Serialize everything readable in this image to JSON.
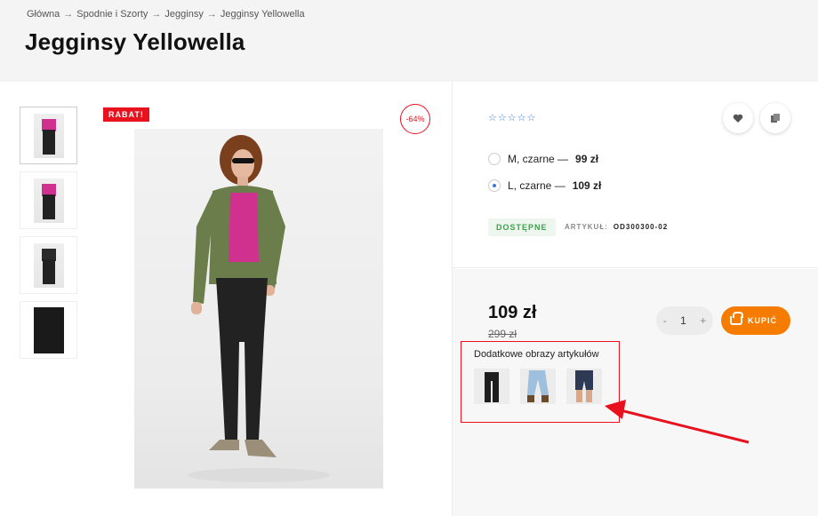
{
  "breadcrumb": {
    "items": [
      "Główna",
      "Spodnie i Szorty",
      "Jegginsy",
      "Jegginsy Yellowella"
    ],
    "separator": "→"
  },
  "page": {
    "title": "Jegginsy Yellowella"
  },
  "gallery": {
    "badge_label": "RABAT!",
    "discount_label": "-64%"
  },
  "product": {
    "rating_stars": "☆☆☆☆☆",
    "variants": [
      {
        "label": "M, czarne —",
        "price": "99 zł",
        "selected": false
      },
      {
        "label": "L, czarne —",
        "price": "109 zł",
        "selected": true
      }
    ],
    "status": "DOSTĘPNE",
    "sku_label": "ARTYKUŁ:",
    "sku_value": "OD300300-02",
    "price": "109 zł",
    "old_price": "299 zł",
    "quantity": "1",
    "qty_minus": "-",
    "qty_plus": "+",
    "buy_label": "KUPIĆ",
    "extra_images_title": "Dodatkowe obrazy artykułów"
  },
  "icons": {
    "wishlist": "heart-icon",
    "compare": "copy-icon",
    "buy": "basket-icon"
  },
  "colors": {
    "accent_orange": "#f57c00",
    "sale_red": "#e8121f",
    "available_green": "#3aa34a",
    "radio_blue": "#3a7ad8"
  }
}
